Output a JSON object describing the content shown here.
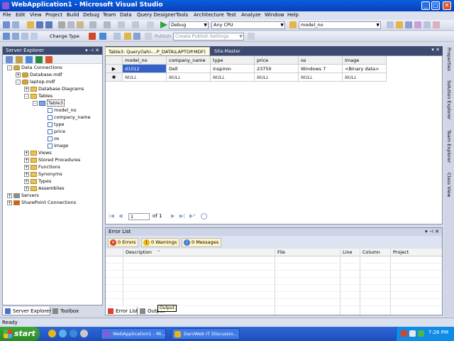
{
  "window": {
    "title": "WebApplication1 - Microsoft Visual Studio"
  },
  "menu": [
    "File",
    "Edit",
    "View",
    "Project",
    "Build",
    "Debug",
    "Team",
    "Data",
    "Query Designer",
    "Tools",
    "Architecture",
    "Test",
    "Analyze",
    "Window",
    "Help"
  ],
  "toolbar": {
    "config": "Debug",
    "platform": "Any CPU",
    "find": "model_no",
    "change_type": "Change Type",
    "publish_label": "Publish:",
    "publish_settings": "Create Publish Settings"
  },
  "server_explorer": {
    "title": "Server Explorer",
    "items": [
      {
        "label": "Data Connections",
        "level": 0,
        "exp": "-",
        "icon": "db"
      },
      {
        "label": "Database.mdf",
        "level": 1,
        "exp": "+",
        "icon": "db"
      },
      {
        "label": "laptop.mdf",
        "level": 1,
        "exp": "-",
        "icon": "db"
      },
      {
        "label": "Database Diagrams",
        "level": 2,
        "exp": "+",
        "icon": "folder"
      },
      {
        "label": "Tables",
        "level": 2,
        "exp": "-",
        "icon": "folder"
      },
      {
        "label": "Table3",
        "level": 3,
        "exp": "-",
        "icon": "tbl"
      },
      {
        "label": "model_no",
        "level": 4,
        "exp": "",
        "icon": "col"
      },
      {
        "label": "company_name",
        "level": 4,
        "exp": "",
        "icon": "col"
      },
      {
        "label": "type",
        "level": 4,
        "exp": "",
        "icon": "col"
      },
      {
        "label": "price",
        "level": 4,
        "exp": "",
        "icon": "col"
      },
      {
        "label": "os",
        "level": 4,
        "exp": "",
        "icon": "col"
      },
      {
        "label": "image",
        "level": 4,
        "exp": "",
        "icon": "col"
      },
      {
        "label": "Views",
        "level": 2,
        "exp": "+",
        "icon": "folder"
      },
      {
        "label": "Stored Procedures",
        "level": 2,
        "exp": "+",
        "icon": "folder"
      },
      {
        "label": "Functions",
        "level": 2,
        "exp": "+",
        "icon": "folder"
      },
      {
        "label": "Synonyms",
        "level": 2,
        "exp": "+",
        "icon": "folder"
      },
      {
        "label": "Types",
        "level": 2,
        "exp": "+",
        "icon": "folder"
      },
      {
        "label": "Assemblies",
        "level": 2,
        "exp": "+",
        "icon": "folder"
      },
      {
        "label": "Servers",
        "level": 0,
        "exp": "+",
        "icon": "srv"
      },
      {
        "label": "SharePoint Connections",
        "level": 0,
        "exp": "+",
        "icon": "sp"
      }
    ],
    "bottom_tabs": [
      "Server Explorer",
      "Toolbox"
    ]
  },
  "doc_tabs": [
    "Table3: Query(lahi-...P_DATA\\LAPTOP.MDF)",
    "Site.Master"
  ],
  "grid": {
    "columns": [
      "model_no",
      "company_name",
      "type",
      "price",
      "os",
      "image"
    ],
    "rows": [
      {
        "marker": "▶",
        "cells": [
          "d1012",
          "Dell",
          "inspiron",
          "23750",
          "Windows 7",
          "<Binary data>"
        ]
      },
      {
        "marker": "✱",
        "cells": [
          "NULL",
          "NULL",
          "NULL",
          "NULL",
          "NULL",
          "NULL"
        ]
      }
    ],
    "nav": {
      "first": "|◀",
      "prev": "◀",
      "page": "1",
      "of": "of 1",
      "next": "▶",
      "last": "▶|",
      "new": "▶*"
    }
  },
  "error_list": {
    "title": "Error List",
    "filters": [
      {
        "label": "0 Errors",
        "color": "#d9432a",
        "glyph": "✕"
      },
      {
        "label": "0 Warnings",
        "color": "#e8b51e",
        "glyph": "!"
      },
      {
        "label": "0 Messages",
        "color": "#3f7bd8",
        "glyph": "i"
      }
    ],
    "columns": [
      "Description",
      "File",
      "Line",
      "Column",
      "Project"
    ],
    "bottom_tabs": [
      "Error List",
      "Output"
    ],
    "tooltip": "Output"
  },
  "right_rail": [
    "Properties",
    "Solution Explorer",
    "Team Explorer",
    "Class View"
  ],
  "status": "Ready",
  "taskbar": {
    "start": "start",
    "tasks": [
      "WebApplication1 - Mi...",
      "DaniWeb IT Discussio..."
    ],
    "clock": "7:26 PM"
  }
}
